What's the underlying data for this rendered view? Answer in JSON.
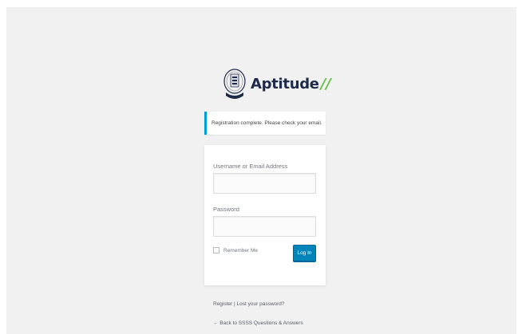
{
  "logo": {
    "text": "Aptitude",
    "slashes": "//",
    "accent_color": "#6cc04a",
    "text_color": "#1e2a4a"
  },
  "notice": {
    "message": "Registration complete. Please check your email.",
    "border_color": "#00a0d2"
  },
  "form": {
    "username_label": "Username or Email Address",
    "username_value": "",
    "password_label": "Password",
    "password_value": "",
    "remember_label": "Remember Me",
    "remember_checked": false,
    "login_label": "Log In",
    "login_color": "#0085ba"
  },
  "nav": {
    "register": "Register",
    "separator": "|",
    "lost_password": "Lost your password?"
  },
  "backlink": {
    "text": "← Back to SSSS Questions & Answers"
  }
}
